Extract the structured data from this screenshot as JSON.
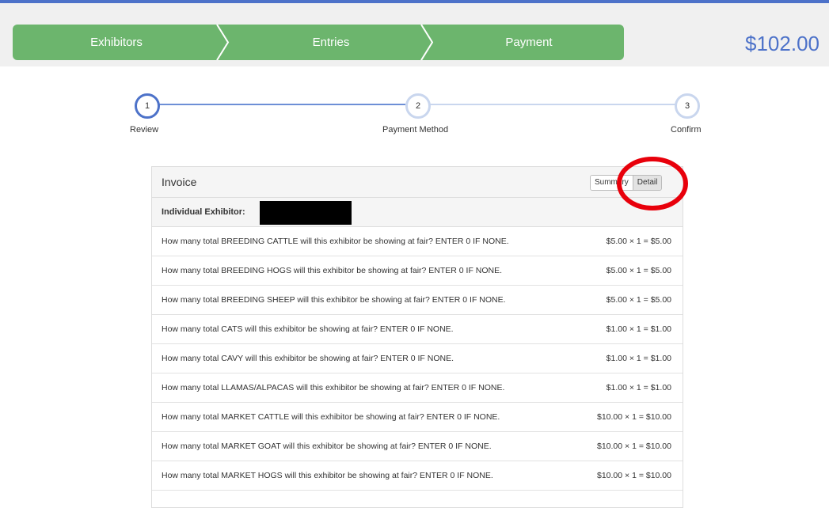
{
  "header": {
    "steps": [
      "Exhibitors",
      "Entries",
      "Payment"
    ],
    "total": "$102.00"
  },
  "stepper": {
    "steps": [
      {
        "number": "1",
        "label": "Review",
        "active": true
      },
      {
        "number": "2",
        "label": "Payment Method",
        "active": false
      },
      {
        "number": "3",
        "label": "Confirm",
        "active": false
      }
    ]
  },
  "invoice": {
    "title": "Invoice",
    "toggle": {
      "summary": "Summary",
      "detail": "Detail",
      "selected": "Detail"
    },
    "exhibitor_label": "Individual Exhibitor:",
    "items": [
      {
        "question": "How many total BREEDING CATTLE will this exhibitor be showing at fair? ENTER 0 IF NONE.",
        "amount": "$5.00 × 1 = $5.00"
      },
      {
        "question": "How many total BREEDING HOGS will this exhibitor be showing at fair? ENTER 0 IF NONE.",
        "amount": "$5.00 × 1 = $5.00"
      },
      {
        "question": "How many total BREEDING SHEEP will this exhibitor be showing at fair? ENTER 0 IF NONE.",
        "amount": "$5.00 × 1 = $5.00"
      },
      {
        "question": "How many total CATS will this exhibitor be showing at fair? ENTER 0 IF NONE.",
        "amount": "$1.00 × 1 = $1.00"
      },
      {
        "question": "How many total CAVY will this exhibitor be showing at fair? ENTER 0 IF NONE.",
        "amount": "$1.00 × 1 = $1.00"
      },
      {
        "question": "How many total LLAMAS/ALPACAS will this exhibitor be showing at fair? ENTER 0 IF NONE.",
        "amount": "$1.00 × 1 = $1.00"
      },
      {
        "question": "How many total MARKET CATTLE will this exhibitor be showing at fair? ENTER 0 IF NONE.",
        "amount": "$10.00 × 1 = $10.00"
      },
      {
        "question": "How many total MARKET GOAT will this exhibitor be showing at fair? ENTER 0 IF NONE.",
        "amount": "$10.00 × 1 = $10.00"
      },
      {
        "question": "How many total MARKET HOGS will this exhibitor be showing at fair? ENTER 0 IF NONE.",
        "amount": "$10.00 × 1 = $10.00"
      }
    ]
  },
  "colors": {
    "accent": "#4d72c9",
    "breadcrumb": "#6cb56d",
    "annotation": "#e8000b"
  }
}
